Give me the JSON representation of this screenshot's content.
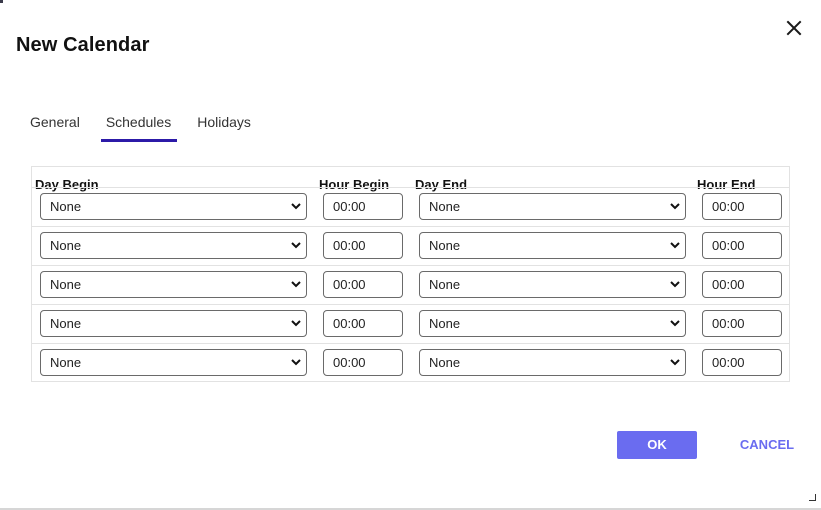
{
  "dialog": {
    "title": "New Calendar",
    "close_icon": "close-icon"
  },
  "tabs": [
    {
      "label": "General",
      "active": false
    },
    {
      "label": "Schedules",
      "active": true
    },
    {
      "label": "Holidays",
      "active": false
    }
  ],
  "table": {
    "headers": {
      "day_begin": "Day Begin",
      "hour_begin": "Hour Begin",
      "day_end": "Day End",
      "hour_end": "Hour End"
    },
    "rows": [
      {
        "day_begin": "None",
        "hour_begin": "00:00",
        "day_end": "None",
        "hour_end": "00:00"
      },
      {
        "day_begin": "None",
        "hour_begin": "00:00",
        "day_end": "None",
        "hour_end": "00:00"
      },
      {
        "day_begin": "None",
        "hour_begin": "00:00",
        "day_end": "None",
        "hour_end": "00:00"
      },
      {
        "day_begin": "None",
        "hour_begin": "00:00",
        "day_end": "None",
        "hour_end": "00:00"
      },
      {
        "day_begin": "None",
        "hour_begin": "00:00",
        "day_end": "None",
        "hour_end": "00:00"
      }
    ]
  },
  "footer": {
    "ok_label": "OK",
    "cancel_label": "CANCEL"
  },
  "colors": {
    "accent": "#6a6cf0",
    "tab_underline": "#2c1aa8"
  }
}
